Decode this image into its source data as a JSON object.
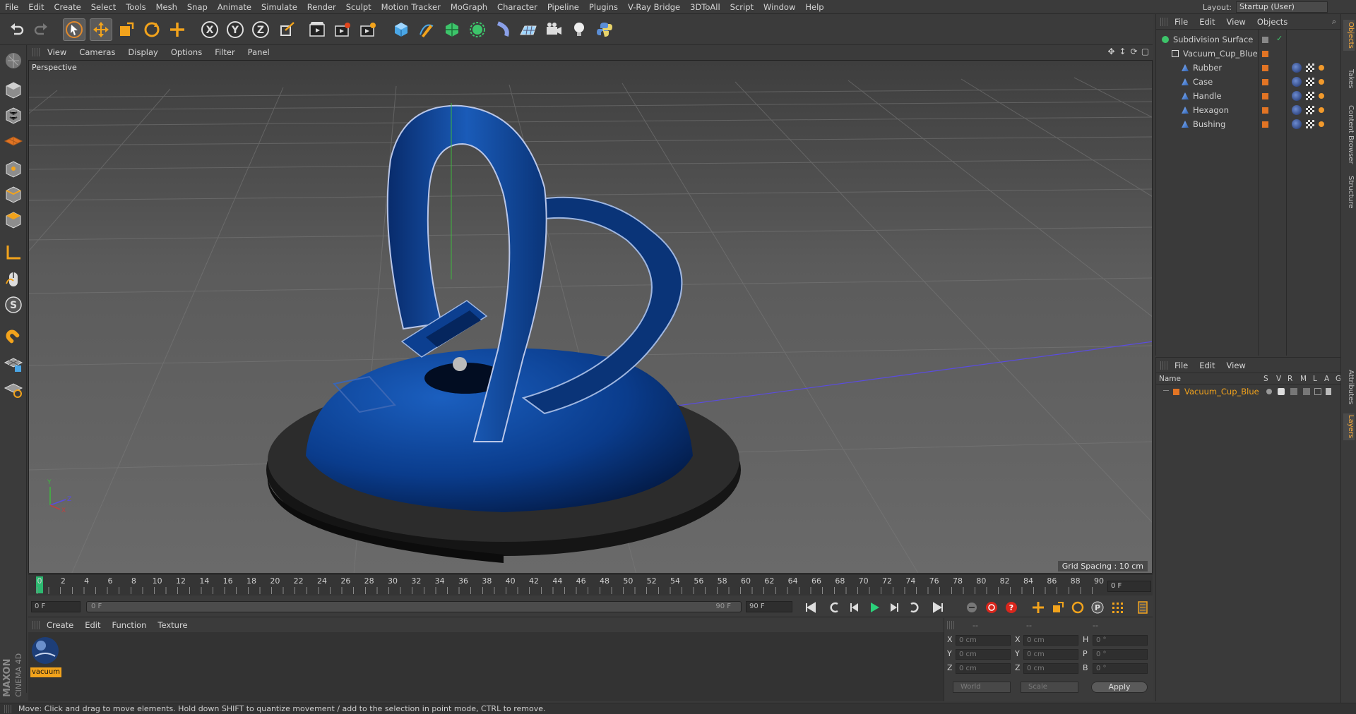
{
  "menu": [
    "File",
    "Edit",
    "Create",
    "Select",
    "Tools",
    "Mesh",
    "Snap",
    "Animate",
    "Simulate",
    "Render",
    "Sculpt",
    "Motion Tracker",
    "MoGraph",
    "Character",
    "Pipeline",
    "Plugins",
    "V-Ray Bridge",
    "3DToAll",
    "Script",
    "Window",
    "Help"
  ],
  "layout": {
    "label": "Layout:",
    "value": "Startup (User)"
  },
  "viewport": {
    "menu": [
      "View",
      "Cameras",
      "Display",
      "Options",
      "Filter",
      "Panel"
    ],
    "label": "Perspective",
    "grid_spacing": "Grid Spacing : 10 cm"
  },
  "timeline": {
    "ticks": [
      "0",
      "2",
      "4",
      "6",
      "8",
      "10",
      "12",
      "14",
      "16",
      "18",
      "20",
      "22",
      "24",
      "26",
      "28",
      "30",
      "32",
      "34",
      "36",
      "38",
      "40",
      "42",
      "44",
      "46",
      "48",
      "50",
      "52",
      "54",
      "56",
      "58",
      "60",
      "62",
      "64",
      "66",
      "68",
      "70",
      "72",
      "74",
      "76",
      "78",
      "80",
      "82",
      "84",
      "86",
      "88",
      "90"
    ],
    "current_frame": "0 F",
    "start_field": "0 F",
    "range_start": "0 F",
    "range_end": "90 F",
    "end_field": "90 F"
  },
  "material_manager": {
    "menu": [
      "Create",
      "Edit",
      "Function",
      "Texture"
    ],
    "materials": [
      {
        "name": "vacuum"
      }
    ]
  },
  "coordinates": {
    "header": [
      "--",
      "--",
      "--"
    ],
    "rows": [
      {
        "a": "X",
        "av": "0 cm",
        "b": "X",
        "bv": "0 cm",
        "c": "H",
        "cv": "0 °"
      },
      {
        "a": "Y",
        "av": "0 cm",
        "b": "Y",
        "bv": "0 cm",
        "c": "P",
        "cv": "0 °"
      },
      {
        "a": "Z",
        "av": "0 cm",
        "b": "Z",
        "bv": "0 cm",
        "c": "B",
        "cv": "0 °"
      }
    ],
    "mode": "World",
    "size_mode": "Scale",
    "apply": "Apply"
  },
  "status": "Move: Click and drag to move elements. Hold down SHIFT to quantize movement / add to the selection in point mode, CTRL to remove.",
  "object_manager": {
    "menu": [
      "File",
      "Edit",
      "View",
      "Objects"
    ],
    "objects": [
      {
        "name": "Subdivision Surface",
        "indent": 0
      },
      {
        "name": "Vacuum_Cup_Blue",
        "indent": 1
      },
      {
        "name": "Rubber",
        "indent": 2
      },
      {
        "name": "Case",
        "indent": 2
      },
      {
        "name": "Handle",
        "indent": 2
      },
      {
        "name": "Hexagon",
        "indent": 2
      },
      {
        "name": "Bushing",
        "indent": 2
      }
    ]
  },
  "layer_manager": {
    "menu": [
      "File",
      "Edit",
      "View"
    ],
    "columns": [
      "Name",
      "S",
      "V",
      "R",
      "M",
      "L",
      "A",
      "G"
    ],
    "layers": [
      {
        "name": "Vacuum_Cup_Blue"
      }
    ]
  },
  "side_tabs": [
    "Objects",
    "Takes",
    "Content Browser",
    "Structure",
    "Attributes",
    "Layers"
  ],
  "colors": {
    "accent": "#f2a31c",
    "object_blue": "#0b3f8f",
    "layer_name": "#f2a31c"
  }
}
